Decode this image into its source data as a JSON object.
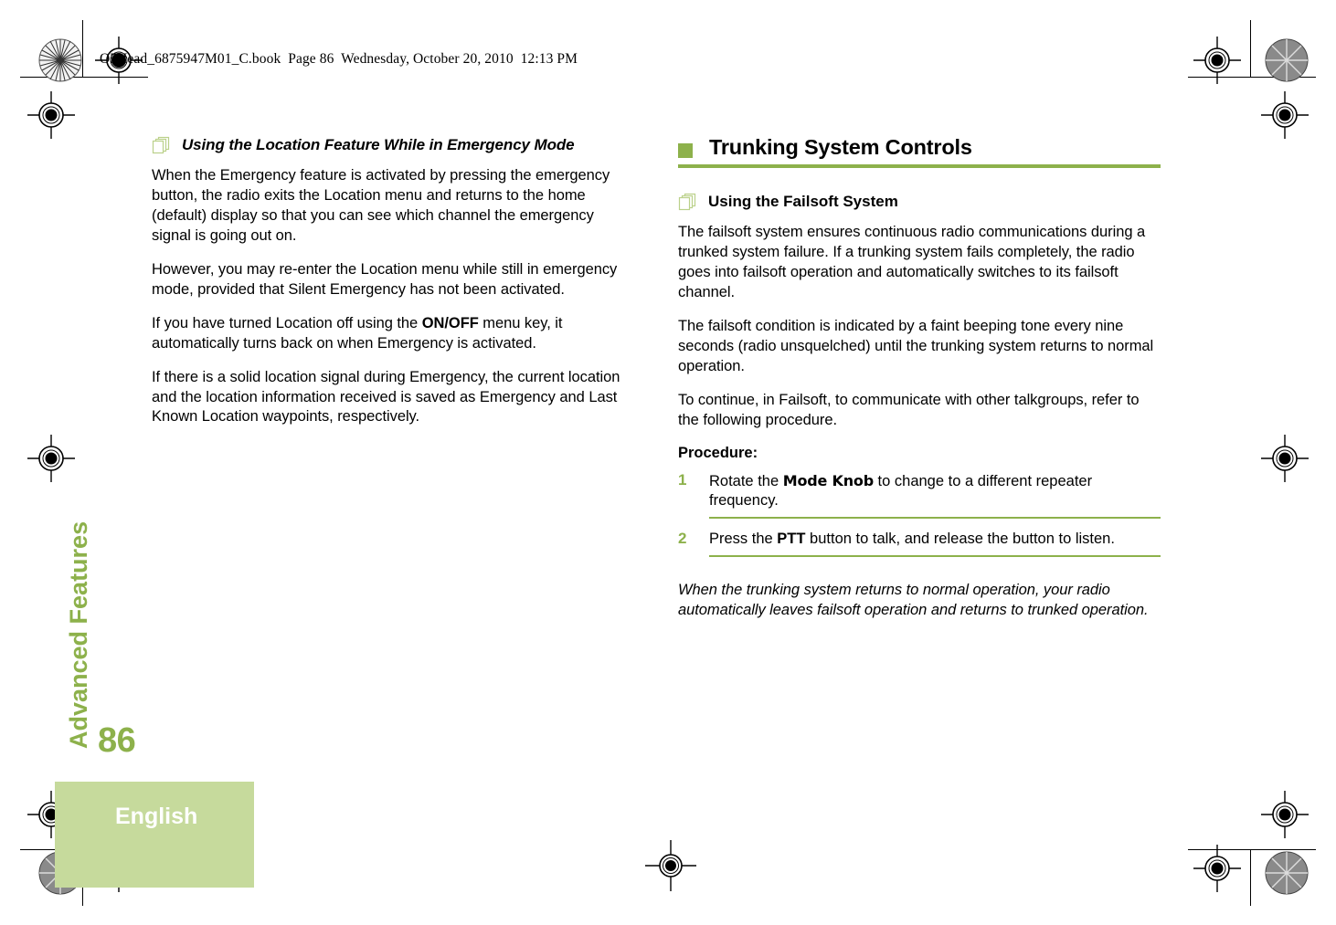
{
  "file_header": "O5Head_6875947M01_C.book  Page 86  Wednesday, October 20, 2010  12:13 PM",
  "colors": {
    "accent_green": "#8DB14B",
    "light_green": "#C6DA9C",
    "text": "#000000"
  },
  "chapter_tab": {
    "label": "Advanced Features"
  },
  "footer": {
    "page_number": "86",
    "language": "English"
  },
  "left_column": {
    "subheading": {
      "icon": "page-stack-icon",
      "text": "Using the Location Feature While in Emergency Mode"
    },
    "paragraphs": [
      "When the Emergency feature is activated by pressing the emergency button, the radio exits the Location menu and returns to the home (default) display so that you can see which channel the emergency signal is going out on.",
      "However, you may re-enter the Location menu while still in emergency mode, provided that Silent Emergency has not been activated.",
      "If there is a solid location signal during Emergency, the current location and the location information received is saved as Emergency and Last Known Location waypoints, respectively."
    ],
    "onoff_paragraph": {
      "before": "If you have turned Location off using the ",
      "bold": "ON/OFF",
      "after": " menu key, it automatically turns back on when Emergency is activated."
    }
  },
  "right_column": {
    "section_title": "Trunking System Controls",
    "subheading": {
      "icon": "page-stack-icon",
      "text": "Using the Failsoft System"
    },
    "paragraphs": [
      "The failsoft system ensures continuous radio communications during a trunked system failure. If a trunking system fails completely, the radio goes into failsoft operation and automatically switches to its failsoft channel.",
      "The failsoft condition is indicated by a faint beeping tone every nine seconds (radio unsquelched) until the trunking system returns to normal operation.",
      "To continue, in Failsoft, to communicate with other talkgroups, refer to the following procedure."
    ],
    "procedure_label": "Procedure:",
    "steps": [
      {
        "number": "1",
        "before": "Rotate the ",
        "bold": "Mode Knob",
        "after": " to change to a different repeater frequency."
      },
      {
        "number": "2",
        "before": "Press the ",
        "bold": "PTT",
        "after": " button to talk, and release the button to listen."
      }
    ],
    "closing_note": "When the trunking system returns to normal operation, your radio automatically leaves failsoft operation and returns to trunked operation."
  }
}
